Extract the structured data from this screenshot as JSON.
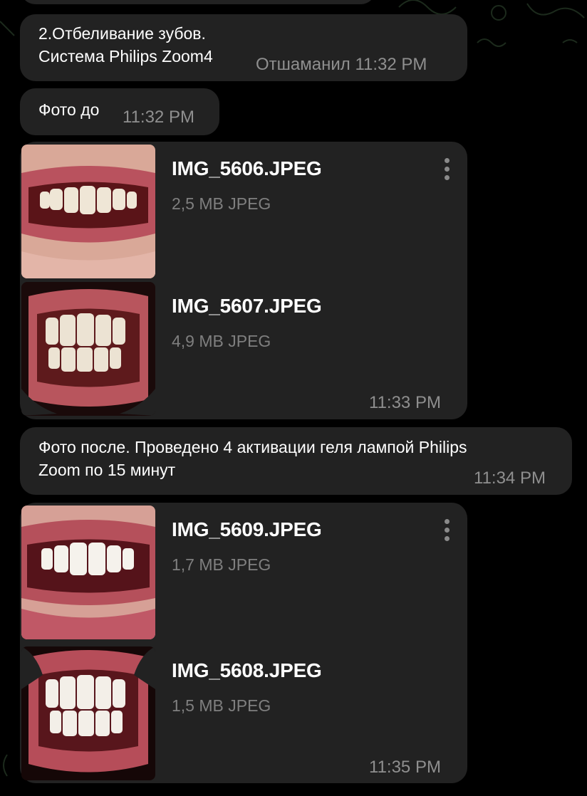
{
  "messages": {
    "m1": {
      "line1": "2.Отбеливание зубов.",
      "line2": "Система Philips Zoom4",
      "meta": "Отшаманил 11:32 PM"
    },
    "m2": {
      "text": "Фото до",
      "time": "11:32 PM"
    },
    "files1": {
      "items": [
        {
          "name": "IMG_5606.JPEG",
          "meta": "2,5 MB JPEG"
        },
        {
          "name": "IMG_5607.JPEG",
          "meta": "4,9 MB JPEG"
        }
      ],
      "time": "11:33 PM"
    },
    "m3": {
      "line1": "Фото после. Проведено 4 активации геля лампой Philips",
      "line2": "Zoom по 15 минут",
      "time": "11:34 PM"
    },
    "files2": {
      "items": [
        {
          "name": "IMG_5609.JPEG",
          "meta": "1,7 MB JPEG"
        },
        {
          "name": "IMG_5608.JPEG",
          "meta": "1,5 MB JPEG"
        }
      ],
      "time": "11:35 PM"
    }
  },
  "icons": {
    "message_menu": "more-vertical-icon"
  },
  "colors": {
    "background": "#000000",
    "bubble": "#222222",
    "secondary_text": "#8f8f8f"
  }
}
